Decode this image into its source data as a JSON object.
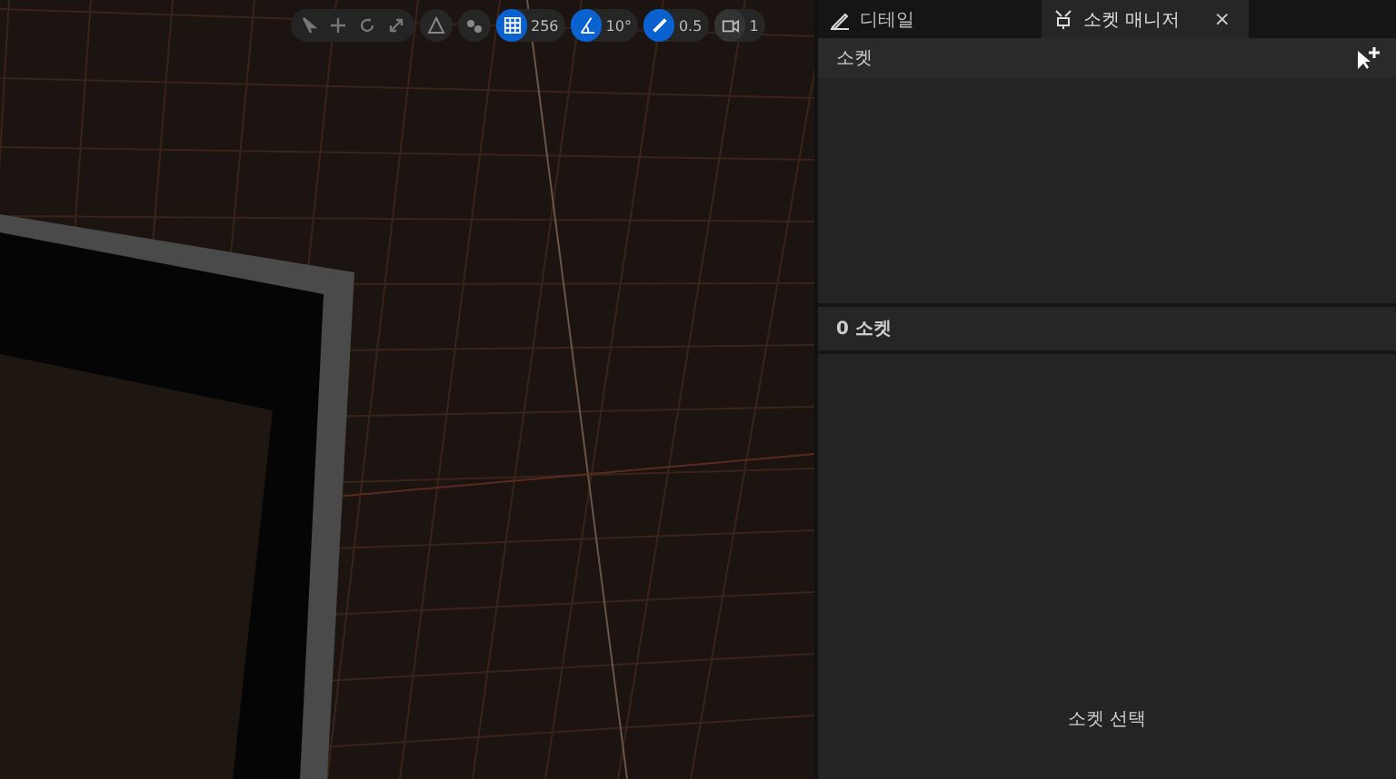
{
  "viewport": {
    "toolbar": {
      "tools": [
        {
          "kind": "select",
          "selected": false
        },
        {
          "kind": "move",
          "selected": false
        },
        {
          "kind": "rotate",
          "selected": false
        },
        {
          "kind": "scale",
          "selected": false
        }
      ],
      "snaps": [
        {
          "kind": "grid",
          "on": true,
          "value": "256"
        },
        {
          "kind": "angle",
          "on": true,
          "value": "10°"
        },
        {
          "kind": "scale",
          "on": true,
          "value": "0.5"
        },
        {
          "kind": "camera",
          "on": false,
          "value": "1"
        }
      ]
    }
  },
  "tabs": [
    {
      "label": "디테일",
      "kind": "details",
      "selected": false
    },
    {
      "label": "소켓 매니저",
      "kind": "sockets",
      "selected": true,
      "close": "×"
    }
  ],
  "socket_panel": {
    "header": "소켓",
    "count": "0 소켓",
    "empty_message": "소켓 선택"
  }
}
